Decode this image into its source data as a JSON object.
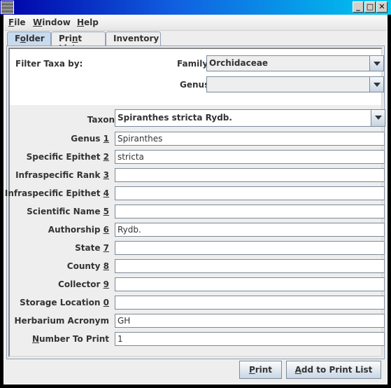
{
  "window": {
    "controls": [
      "minimize",
      "maximize",
      "close"
    ]
  },
  "menu": [
    {
      "m": "F",
      "rest": "ile"
    },
    {
      "m": "W",
      "rest": "indow"
    },
    {
      "m": "H",
      "rest": "elp"
    }
  ],
  "tabs": [
    {
      "pre": "F",
      "m": "o",
      "post": "lder",
      "selected": true
    },
    {
      "pre": "Pri",
      "m": "n",
      "post": "t List"
    },
    {
      "pre": "Inventory",
      "m": "",
      "post": ""
    }
  ],
  "filter": {
    "title": "Filter Taxa by:",
    "family_label": "Family",
    "family_value": "Orchidaceae",
    "genus_label": "Genus",
    "genus_value": ""
  },
  "taxon": {
    "label": "Taxon",
    "value": "Spiranthes stricta Rydb."
  },
  "fields": [
    {
      "pre": "Genus ",
      "m": "1",
      "post": "",
      "value": "Spiranthes"
    },
    {
      "pre": "Specific Epithet ",
      "m": "2",
      "post": "",
      "value": "stricta"
    },
    {
      "pre": "Infraspecific Rank ",
      "m": "3",
      "post": "",
      "value": ""
    },
    {
      "pre": "Infraspecific Epithet ",
      "m": "4",
      "post": "",
      "value": ""
    },
    {
      "pre": "Scientific Name ",
      "m": "5",
      "post": "",
      "value": ""
    },
    {
      "pre": "Authorship ",
      "m": "6",
      "post": "",
      "value": "Rydb."
    },
    {
      "pre": "State ",
      "m": "7",
      "post": "",
      "value": ""
    },
    {
      "pre": "County ",
      "m": "8",
      "post": "",
      "value": ""
    },
    {
      "pre": "Collector ",
      "m": "9",
      "post": "",
      "value": ""
    },
    {
      "pre": "Storage Location ",
      "m": "0",
      "post": "",
      "value": ""
    },
    {
      "pre": "Herbarium Acronym",
      "m": "",
      "post": "",
      "value": "GH"
    },
    {
      "pre": "",
      "m": "N",
      "post": "umber To Print",
      "value": "1"
    }
  ],
  "buttons": {
    "print": {
      "m": "P",
      "rest": "rint"
    },
    "add": {
      "m": "A",
      "rest": "dd to Print List"
    }
  },
  "colors": {
    "title_start": "#0000a8",
    "title_end": "#00c8f0",
    "tab_selected": "#c8daee"
  }
}
